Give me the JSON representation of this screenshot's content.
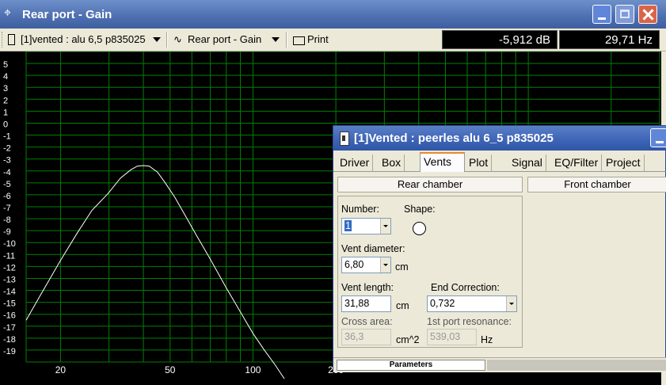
{
  "window": {
    "title": "Rear port - Gain"
  },
  "toolbar": {
    "project_dropdown": "[1]vented : alu 6,5 p835025",
    "graph_dropdown": "Rear port - Gain",
    "print_label": "Print",
    "readout_db": "-5,912 dB",
    "readout_hz": "29,71 Hz"
  },
  "chart_data": {
    "type": "line",
    "title": "Rear port - Gain",
    "xscale": "log",
    "xlim": [
      15,
      3000
    ],
    "ylim": [
      -20,
      6
    ],
    "yticks": [
      "5",
      "4",
      "3",
      "2",
      "1",
      "0",
      "-1",
      "-2",
      "-3",
      "-4",
      "-5",
      "-6",
      "-7",
      "-8",
      "-9",
      "-10",
      "-11",
      "-12",
      "-13",
      "-14",
      "-15",
      "-16",
      "-17",
      "-18",
      "-19"
    ],
    "xticks": [
      "20",
      "50",
      "100",
      "200"
    ],
    "grid": true,
    "colors": {
      "background": "#000000",
      "grid": "#008000",
      "curve": "#ffffff",
      "labels": "#ffffff"
    },
    "series": [
      {
        "x": [
          15,
          17,
          20,
          23,
          26,
          29.71,
          33,
          36,
          38,
          40,
          42,
          45,
          48,
          52,
          56,
          62,
          70,
          80,
          90,
          100,
          110,
          120,
          130
        ],
        "y": [
          -16.5,
          -14.3,
          -11.5,
          -9.2,
          -7.3,
          -5.912,
          -4.6,
          -3.9,
          -3.6,
          -3.55,
          -3.6,
          -4.1,
          -5.0,
          -6.2,
          -7.5,
          -9.3,
          -11.4,
          -13.8,
          -15.8,
          -17.6,
          -19.0,
          -20.2,
          -21.4
        ]
      }
    ]
  },
  "dialog": {
    "title": "[1]Vented : peerles alu 6_5 p835025",
    "tabs": [
      "Driver",
      "Box",
      "Vents",
      "Plot",
      "Signal",
      "EQ/Filter",
      "Project"
    ],
    "active_tab": "Vents",
    "rear_chamber": "Rear chamber",
    "front_chamber": "Front chamber",
    "number_label": "Number:",
    "number_value": "1",
    "shape_label": "Shape:",
    "vent_diameter_label": "Vent diameter:",
    "vent_diameter_value": "6,80",
    "vent_diameter_unit": "cm",
    "vent_length_label": "Vent length:",
    "vent_length_value": "31,88",
    "vent_length_unit": "cm",
    "end_correction_label": "End Correction:",
    "end_correction_value": "0,732",
    "cross_area_label": "Cross area:",
    "cross_area_value": "36,3",
    "cross_area_unit": "cm^2",
    "port_resonance_label": "1st port resonance:",
    "port_resonance_value": "539,03",
    "port_resonance_unit": "Hz",
    "parameters_tab": "Parameters"
  }
}
